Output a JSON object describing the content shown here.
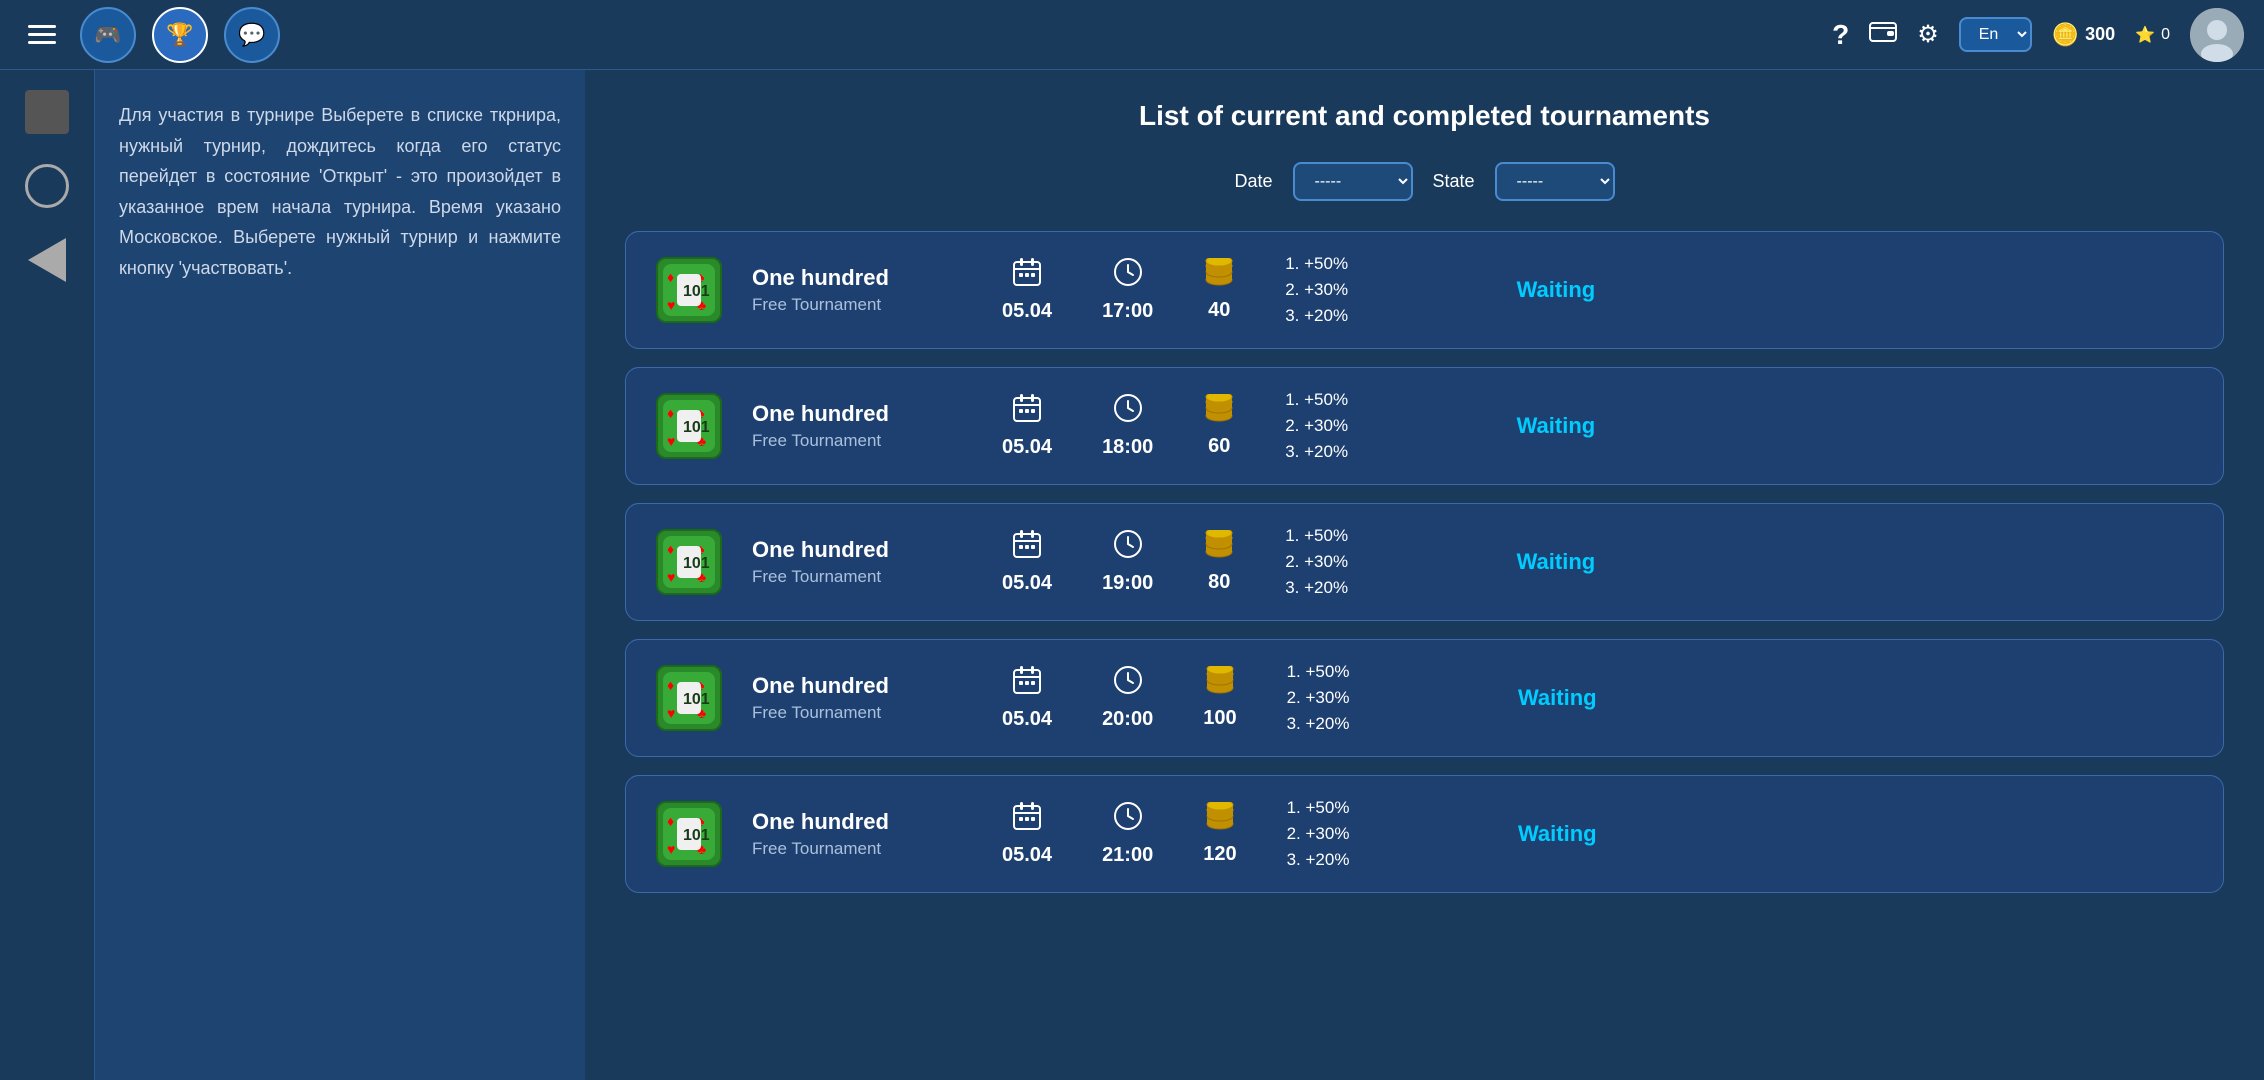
{
  "topbar": {
    "nav_buttons": [
      {
        "id": "controller",
        "icon": "🎮",
        "active": false
      },
      {
        "id": "trophy",
        "icon": "🏆",
        "active": true
      },
      {
        "id": "chat",
        "icon": "💬",
        "active": false
      }
    ],
    "help_label": "?",
    "settings_icon": "⚙",
    "wallet_icon": "💼",
    "language": "En",
    "coins": "300",
    "stars": "0"
  },
  "filters": {
    "date_label": "Date",
    "date_value": "-----",
    "state_label": "State",
    "state_value": "-----"
  },
  "page_title": "List of current and completed tournaments",
  "left_panel": {
    "instruction": "Для участия в турнире Выберете в списке ткрнира, нужный турнир, дождитесь когда его статус перейдет в состояние 'Открыт' - это произойдет в указанное врем начала турнира. Время указано Московское. Выберете нужный турнир и нажмите кнопку 'участвовать'."
  },
  "tournaments": [
    {
      "id": 1,
      "name": "One hundred",
      "sub": "Free Tournament",
      "date": "05.04",
      "time": "17:00",
      "players": "40",
      "prizes": [
        "1. +50%",
        "2. +30%",
        "3. +20%"
      ],
      "status": "Waiting"
    },
    {
      "id": 2,
      "name": "One hundred",
      "sub": "Free Tournament",
      "date": "05.04",
      "time": "18:00",
      "players": "60",
      "prizes": [
        "1. +50%",
        "2. +30%",
        "3. +20%"
      ],
      "status": "Waiting"
    },
    {
      "id": 3,
      "name": "One hundred",
      "sub": "Free Tournament",
      "date": "05.04",
      "time": "19:00",
      "players": "80",
      "prizes": [
        "1. +50%",
        "2. +30%",
        "3. +20%"
      ],
      "status": "Waiting"
    },
    {
      "id": 4,
      "name": "One hundred",
      "sub": "Free Tournament",
      "date": "05.04",
      "time": "20:00",
      "players": "100",
      "prizes": [
        "1. +50%",
        "2. +30%",
        "3. +20%"
      ],
      "status": "Waiting"
    },
    {
      "id": 5,
      "name": "One hundred",
      "sub": "Free Tournament",
      "date": "05.04",
      "time": "21:00",
      "players": "120",
      "prizes": [
        "1. +50%",
        "2. +30%",
        "3. +20%"
      ],
      "status": "Waiting"
    }
  ]
}
